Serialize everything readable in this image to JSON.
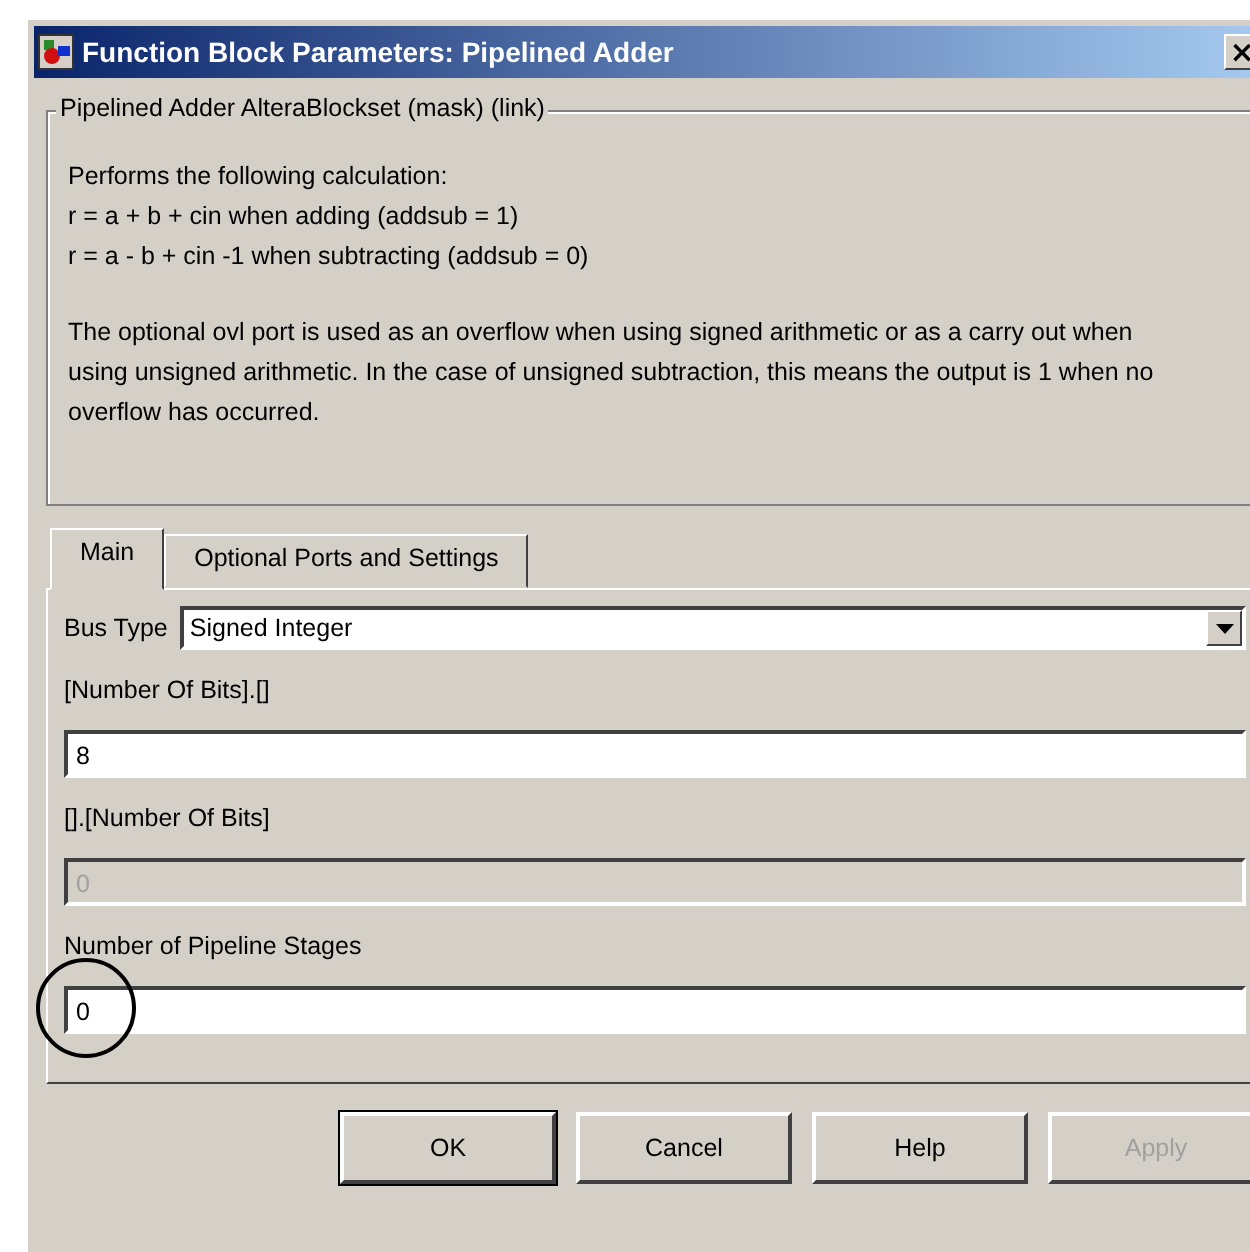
{
  "window": {
    "title": "Function Block Parameters: Pipelined Adder",
    "close": "×"
  },
  "group": {
    "title": "Pipelined Adder AlteraBlockset (mask) (link)",
    "lines": [
      "Performs the following calculation:",
      " r = a + b + cin when adding (addsub = 1)",
      " r = a - b + cin -1 when subtracting (addsub = 0)"
    ],
    "paragraph": "The optional ovl port is used as an overflow when using signed arithmetic or as a carry out when using unsigned arithmetic. In the case of unsigned subtraction, this means the output is 1 when no overflow has occurred."
  },
  "tabs": [
    {
      "label": "Main",
      "selected": true
    },
    {
      "label": "Optional Ports and Settings",
      "selected": false
    }
  ],
  "fields": [
    {
      "kind": "dropdown",
      "label": "Bus Type",
      "value": "Signed Integer"
    },
    {
      "kind": "text",
      "label": "[Number Of Bits].[]",
      "value": "8",
      "disabled": false
    },
    {
      "kind": "text",
      "label": "[].[Number Of Bits]",
      "value": "0",
      "disabled": true
    },
    {
      "kind": "text",
      "label": "Number of Pipeline Stages",
      "value": "0",
      "disabled": false,
      "circled": true
    }
  ],
  "buttons": [
    {
      "label": "OK",
      "disabled": false
    },
    {
      "label": "Cancel",
      "disabled": false
    },
    {
      "label": "Help",
      "disabled": false
    },
    {
      "label": "Apply",
      "disabled": true
    }
  ]
}
